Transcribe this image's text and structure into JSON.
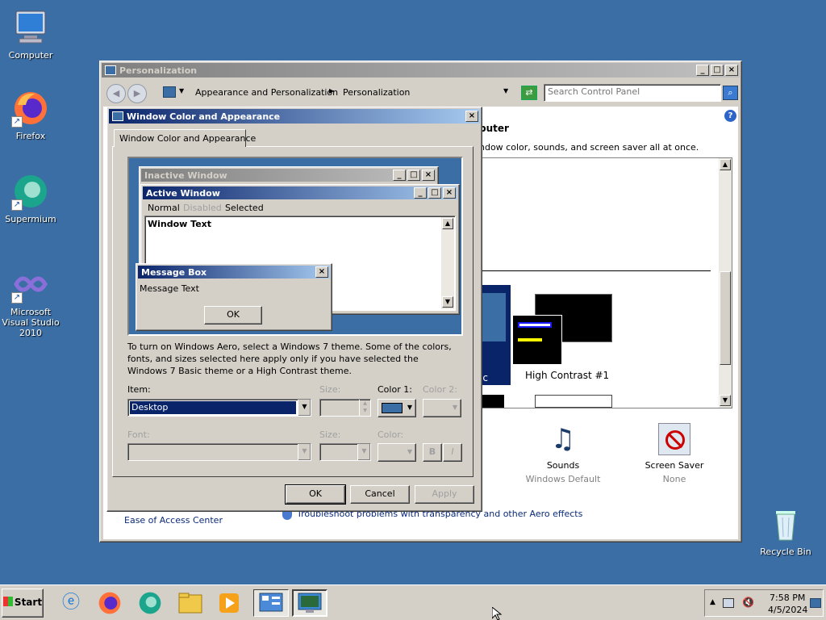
{
  "desktop": {
    "icons": [
      {
        "label": "Computer",
        "icon": "computer-icon"
      },
      {
        "label": "Firefox",
        "icon": "firefox-icon"
      },
      {
        "label": "Supermium",
        "icon": "supermium-icon"
      },
      {
        "label": "Microsoft Visual Studio 2010",
        "icon": "visual-studio-icon"
      },
      {
        "label": "Recycle Bin",
        "icon": "recycle-bin-icon"
      }
    ]
  },
  "personalization": {
    "title": "Personalization",
    "breadcrumb": [
      "Appearance and Personalization",
      "Personalization"
    ],
    "search_placeholder": "Search Control Panel",
    "heading_fragment": "puter",
    "desc_fragment": "ndow color, sounds, and screen saver all at once.",
    "themes": [
      {
        "label": "ic"
      },
      {
        "label": "High Contrast #1"
      }
    ],
    "sounds": {
      "label": "Sounds",
      "value": "Windows Default"
    },
    "screensaver": {
      "label": "Screen Saver",
      "value": "None"
    },
    "ease_of_access": "Ease of Access Center",
    "troubleshoot": "Troubleshoot problems with transparency and other Aero effects"
  },
  "dialog": {
    "title": "Window Color and Appearance",
    "tab": "Window Color and Appearance",
    "preview": {
      "inactive_title": "Inactive Window",
      "active_title": "Active Window",
      "menu": [
        "Normal",
        "Disabled",
        "Selected"
      ],
      "window_text": "Window Text",
      "msgbox_title": "Message Box",
      "msgbox_text": "Message Text",
      "msgbox_ok": "OK"
    },
    "info_text": "To turn on Windows Aero, select a Windows 7 theme.  Some of the colors, fonts, and sizes selected here apply only if you have selected the Windows 7 Basic theme or a High Contrast theme.",
    "item_label": "Item:",
    "item_value": "Desktop",
    "size_label": "Size:",
    "color1_label": "Color 1:",
    "color2_label": "Color 2:",
    "font_label": "Font:",
    "font_size_label": "Size:",
    "font_color_label": "Color:",
    "bold_label": "B",
    "italic_label": "I",
    "color1_value": "#3a6ea5",
    "ok": "OK",
    "cancel": "Cancel",
    "apply": "Apply"
  },
  "taskbar": {
    "start": "Start",
    "apps": [
      "internet-explorer-icon",
      "firefox-icon",
      "supermium-icon",
      "file-explorer-icon",
      "media-player-icon",
      "control-panel-icon",
      "personalization-icon"
    ],
    "time": "7:58 PM",
    "date": "4/5/2024"
  }
}
